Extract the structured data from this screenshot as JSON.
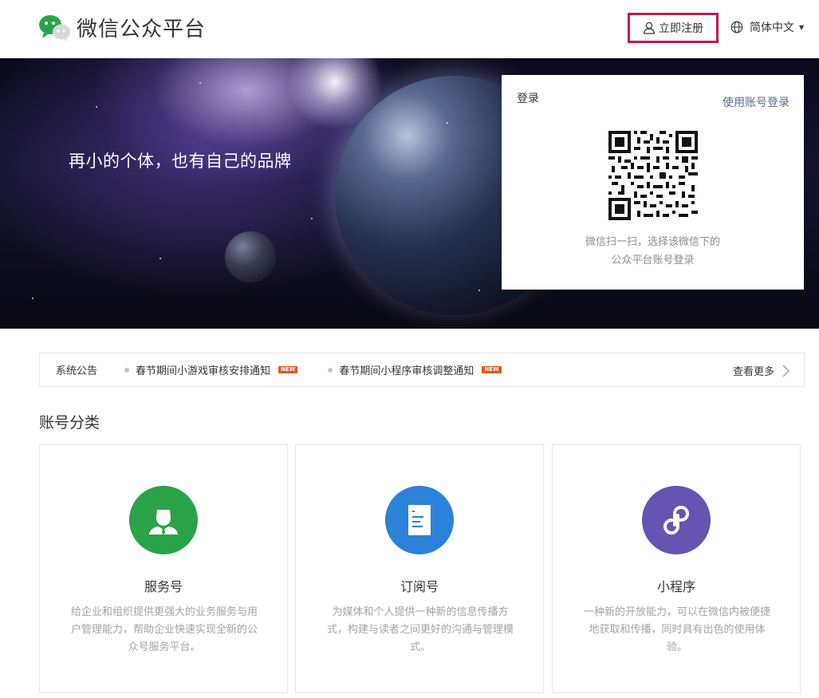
{
  "header": {
    "logo_title": "微信公众平台",
    "register_label": "立即注册",
    "language_label": "简体中文"
  },
  "banner": {
    "slogan": "再小的个体，也有自己的品牌"
  },
  "login": {
    "title": "登录",
    "account_login_link": "使用账号登录",
    "qr_tip_line1": "微信扫一扫，选择该微信下的",
    "qr_tip_line2": "公众平台账号登录"
  },
  "notice": {
    "label": "系统公告",
    "items": [
      {
        "text": "春节期间小游戏审核安排通知",
        "badge": "NEW"
      },
      {
        "text": "春节期间小程序审核调整通知",
        "badge": "NEW"
      }
    ],
    "more_label": "查看更多"
  },
  "account_types": {
    "section_title": "账号分类",
    "cards": [
      {
        "title": "服务号",
        "desc": "给企业和组织提供更强大的业务服务与用户管理能力，帮助企业快速实现全新的公众号服务平台。",
        "icon": "person-icon",
        "color": "#2aa348"
      },
      {
        "title": "订阅号",
        "desc": "为媒体和个人提供一种新的信息传播方式，构建与读者之间更好的沟通与管理模式。",
        "icon": "document-icon",
        "color": "#2b82d9"
      },
      {
        "title": "小程序",
        "desc": "一种新的开放能力，可以在微信内被便捷地获取和传播，同时具有出色的使用体验。",
        "icon": "miniprogram-icon",
        "color": "#6554b2"
      }
    ]
  },
  "colors": {
    "brand_green": "#2aa348",
    "link_blue": "#576b95",
    "highlight_border": "#c7194f",
    "new_badge": "#e5562a"
  }
}
